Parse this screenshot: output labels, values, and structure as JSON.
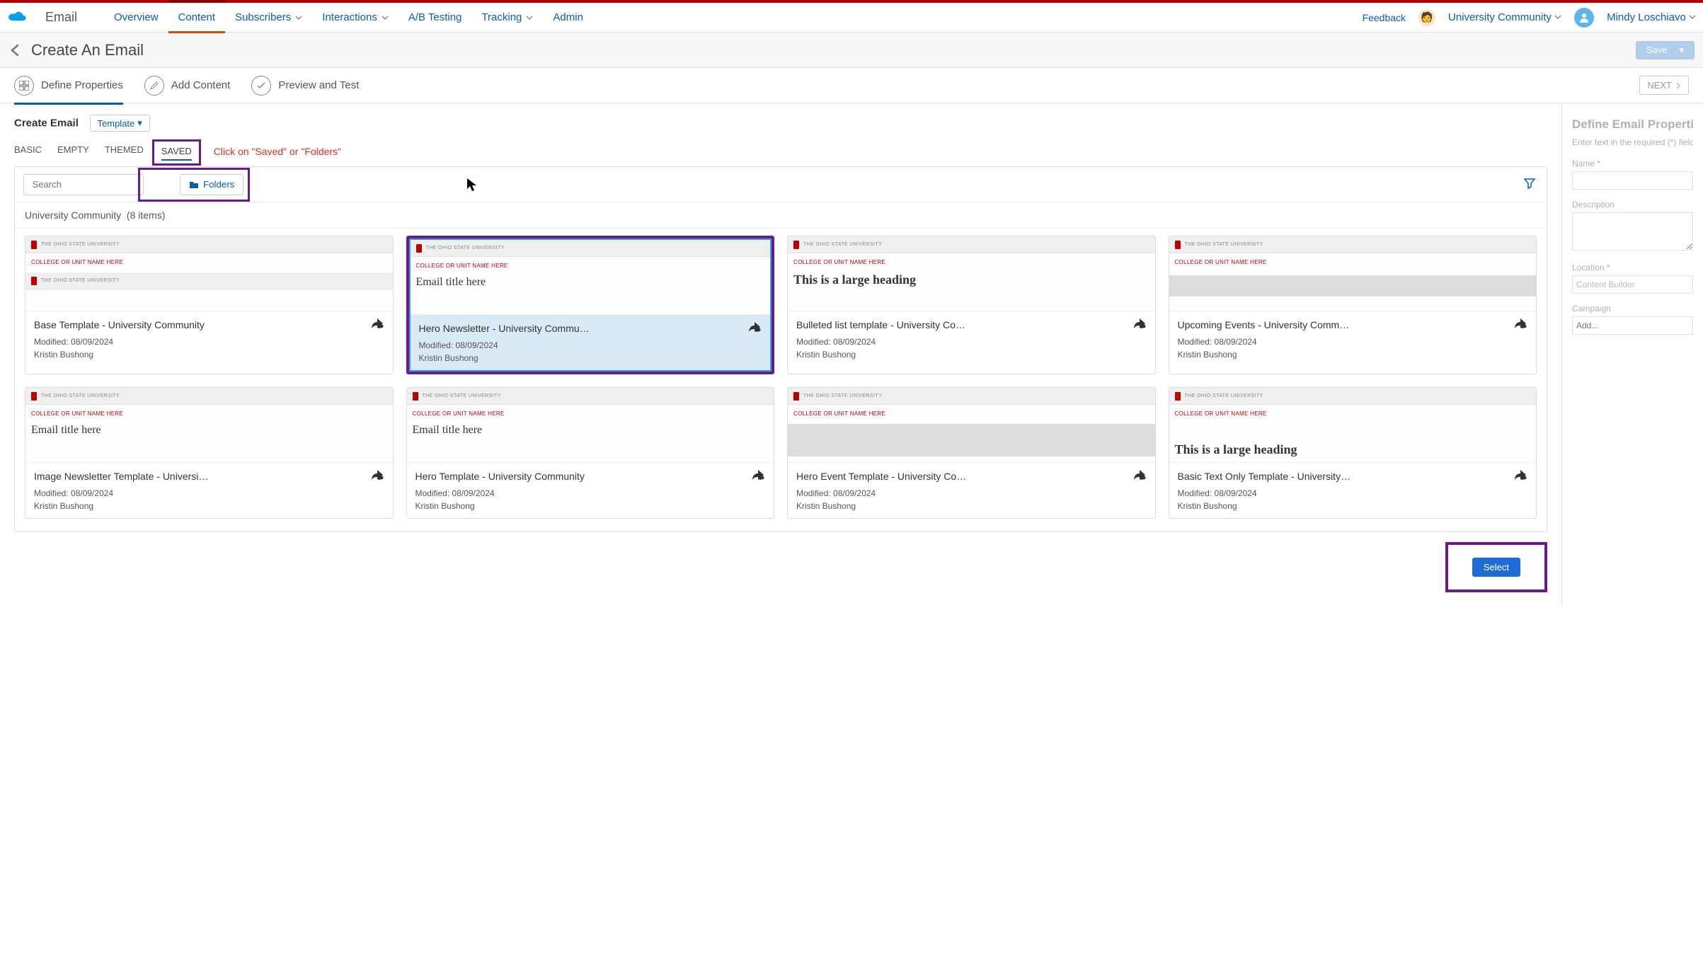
{
  "nav": {
    "app": "Email",
    "items": [
      "Overview",
      "Content",
      "Subscribers",
      "Interactions",
      "A/B Testing",
      "Tracking",
      "Admin"
    ],
    "active_index": 1,
    "dropdown_flags": [
      false,
      false,
      true,
      true,
      false,
      true,
      false
    ],
    "feedback": "Feedback",
    "org": "University Community",
    "user": "Mindy Loschiavo"
  },
  "subhead": {
    "title": "Create An Email",
    "save": "Save"
  },
  "wizard": {
    "steps": [
      "Define Properties",
      "Add Content",
      "Preview and Test"
    ],
    "active_index": 0,
    "next": "NEXT"
  },
  "create": {
    "label": "Create Email",
    "template_btn": "Template"
  },
  "tabs": {
    "items": [
      "BASIC",
      "EMPTY",
      "THEMED",
      "SAVED"
    ],
    "active_index": 3,
    "hint": "Click on \"Saved\" or \"Folders\""
  },
  "toolbar": {
    "search_placeholder": "Search",
    "folders": "Folders"
  },
  "panel": {
    "label": "University Community",
    "count": "(8 items)"
  },
  "thumb_text": {
    "osu": "THE OHIO STATE UNIVERSITY",
    "unit": "COLLEGE OR UNIT NAME HERE",
    "email_title": "Email title here",
    "large_heading": "This is a large heading"
  },
  "cards": [
    {
      "title": "Base Template - University Community",
      "modified": "Modified: 08/09/2024",
      "author": "Kristin Bushong",
      "style": "double-logo"
    },
    {
      "title": "Hero Newsletter - University Commu…",
      "modified": "Modified: 08/09/2024",
      "author": "Kristin Bushong",
      "style": "title",
      "selected": true
    },
    {
      "title": "Bulleted list template - University Co…",
      "modified": "Modified: 08/09/2024",
      "author": "Kristin Bushong",
      "style": "large-heading"
    },
    {
      "title": "Upcoming Events - University Comm…",
      "modified": "Modified: 08/09/2024",
      "author": "Kristin Bushong",
      "style": "grey-block"
    },
    {
      "title": "Image Newsletter Template - Universi…",
      "modified": "Modified: 08/09/2024",
      "author": "Kristin Bushong",
      "style": "title"
    },
    {
      "title": "Hero Template - University Community",
      "modified": "Modified: 08/09/2024",
      "author": "Kristin Bushong",
      "style": "title"
    },
    {
      "title": "Hero Event Template - University Co…",
      "modified": "Modified: 08/09/2024",
      "author": "Kristin Bushong",
      "style": "grey-block-tall"
    },
    {
      "title": "Basic Text Only Template - University…",
      "modified": "Modified: 08/09/2024",
      "author": "Kristin Bushong",
      "style": "large-heading-low"
    }
  ],
  "select_btn": "Select",
  "right": {
    "heading": "Define Email Properties",
    "help": "Enter text in the required (*) field",
    "name_label": "Name *",
    "desc_label": "Description",
    "loc_label": "Location *",
    "loc_value": "Content Builder",
    "campaign_label": "Campaign",
    "campaign_placeholder": "Add..."
  }
}
